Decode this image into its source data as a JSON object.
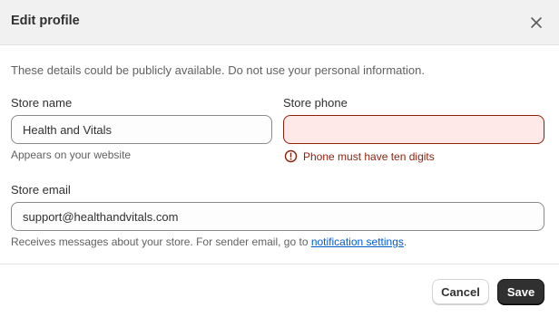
{
  "dialog": {
    "title": "Edit profile",
    "notice": "These details could be publicly available. Do not use your personal information."
  },
  "fields": {
    "store_name": {
      "label": "Store name",
      "value": "Health and Vitals",
      "help": "Appears on your website"
    },
    "store_phone": {
      "label": "Store phone",
      "value": "",
      "error": "Phone must have ten digits"
    },
    "store_email": {
      "label": "Store email",
      "value": "support@healthandvitals.com",
      "help_prefix": "Receives messages about your store. For sender email, go to ",
      "help_link": "notification settings",
      "help_suffix": "."
    }
  },
  "buttons": {
    "cancel": "Cancel",
    "save": "Save"
  },
  "icons": {
    "close": "close-icon",
    "error": "alert-circle-icon"
  },
  "colors": {
    "error": "#8e1f0b",
    "error_bg": "#fee9e8",
    "link": "#005bd3",
    "primary": "#303030"
  }
}
